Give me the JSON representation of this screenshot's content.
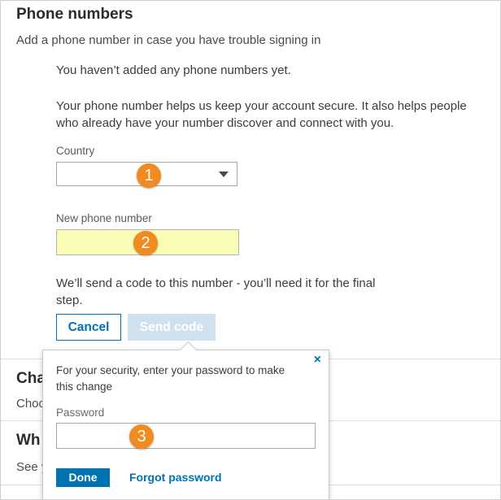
{
  "section": {
    "title": "Phone numbers",
    "subtitle": "Add a phone number in case you have trouble signing in"
  },
  "info": {
    "no_numbers": "You haven’t added any phone numbers yet.",
    "description_line1": "Your phone number helps us keep your account secure. It also helps people",
    "description_line2": "who already have your number discover and connect with you."
  },
  "country": {
    "label": "Country",
    "value": ""
  },
  "phone": {
    "label": "New phone number",
    "value": ""
  },
  "send_note": {
    "line1": "We’ll send a code to this number - you’ll need it for the final",
    "line2": "step."
  },
  "buttons": {
    "cancel": "Cancel",
    "send_code": "Send code"
  },
  "below_sections": [
    {
      "heading": "Cha",
      "text": "Choo"
    },
    {
      "heading": "Wh",
      "text": "See y"
    }
  ],
  "popover": {
    "close_icon": "×",
    "message_line1": "For your security, enter your password to make",
    "message_line2": "this change",
    "password_label": "Password",
    "password_value": "",
    "done": "Done",
    "forgot": "Forgot password"
  },
  "annotations": {
    "badge1": "1",
    "badge2": "2",
    "badge3": "3",
    "color": "#f18a1f"
  },
  "colors": {
    "accent": "#0073b1",
    "send_disabled": "#cfe1ee",
    "phone_field_highlight": "#fafcb6"
  }
}
